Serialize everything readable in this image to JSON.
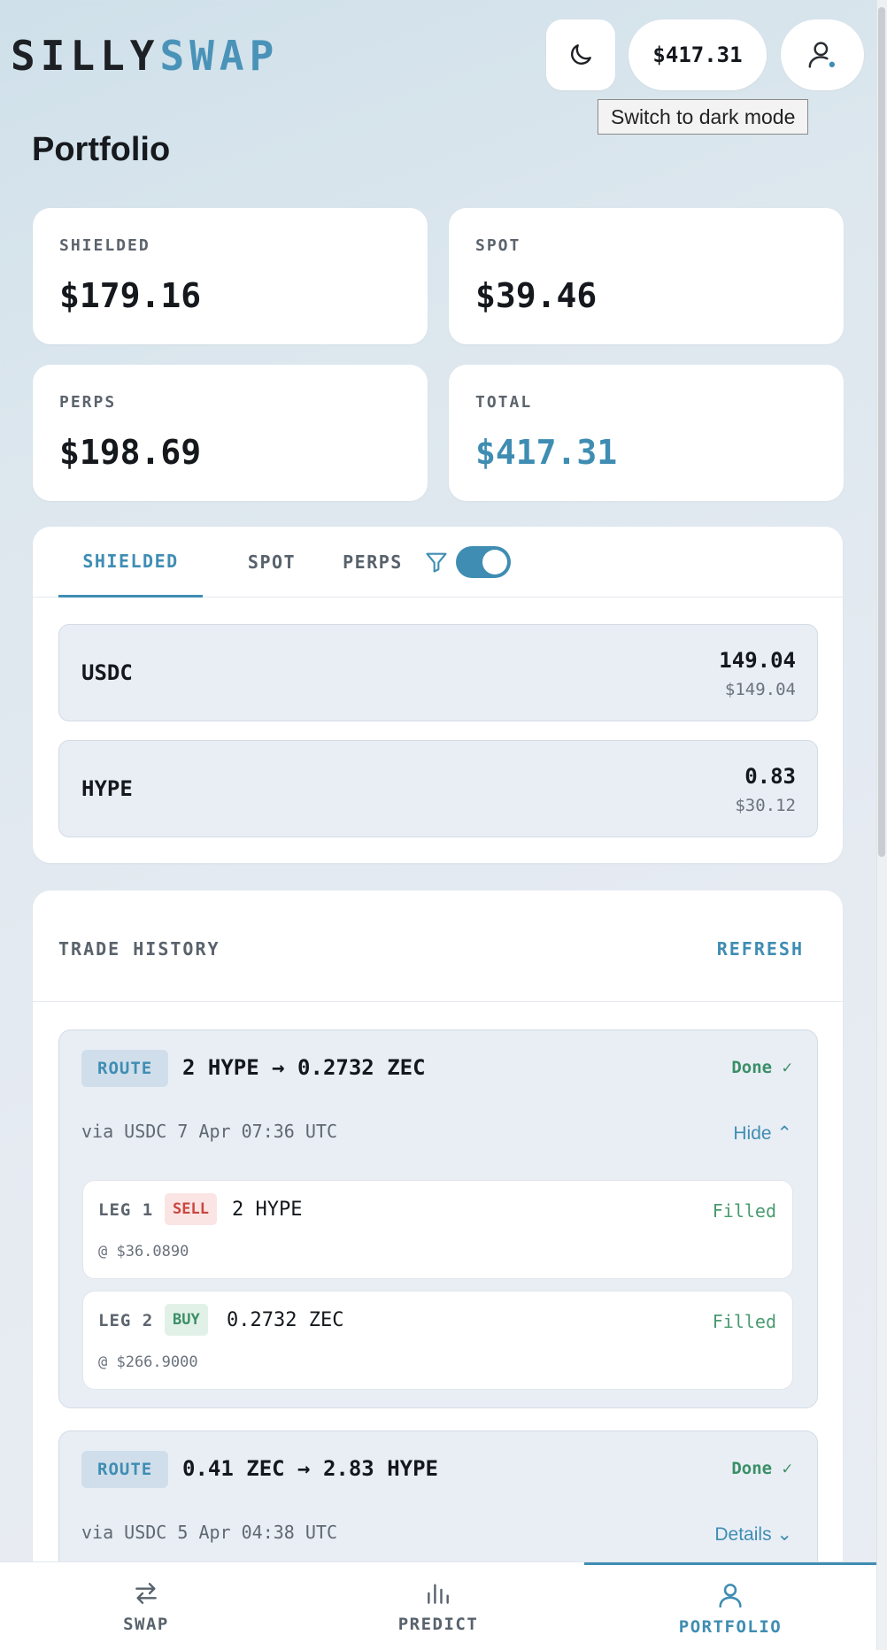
{
  "app": {
    "logo_part1": "SILLY",
    "logo_part2": "SWAP",
    "balance": "$417.31",
    "theme_tooltip": "Switch to dark mode"
  },
  "page": {
    "title": "Portfolio"
  },
  "summary": [
    {
      "label": "SHIELDED",
      "value": "$179.16"
    },
    {
      "label": "SPOT",
      "value": "$39.46"
    },
    {
      "label": "PERPS",
      "value": "$198.69"
    },
    {
      "label": "TOTAL",
      "value": "$417.31"
    }
  ],
  "holdings": {
    "tabs": [
      "SHIELDED",
      "SPOT",
      "PERPS"
    ],
    "active_tab": "SHIELDED",
    "filter_enabled": true,
    "assets": [
      {
        "symbol": "USDC",
        "amount": "149.04",
        "usd": "$149.04"
      },
      {
        "symbol": "HYPE",
        "amount": "0.83",
        "usd": "$30.12"
      }
    ]
  },
  "history": {
    "title": "TRADE HISTORY",
    "refresh_label": "REFRESH",
    "trades": [
      {
        "badge": "ROUTE",
        "summary": "2 HYPE → 0.2732 ZEC",
        "status": "Done ✓",
        "meta": "via USDC 7 Apr 07:36 UTC",
        "toggle": "Hide ⌃",
        "legs": [
          {
            "label": "LEG 1",
            "side": "SELL",
            "qty": "2 HYPE",
            "status": "Filled",
            "price": "@ $36.0890"
          },
          {
            "label": "LEG 2",
            "side": "BUY",
            "qty": "0.2732 ZEC",
            "status": "Filled",
            "price": "@ $266.9000"
          }
        ]
      },
      {
        "badge": "ROUTE",
        "summary": "0.41 ZEC → 2.83 HYPE",
        "status": "Done ✓",
        "meta": "via USDC 5 Apr 04:38 UTC",
        "toggle": "Details ⌄"
      }
    ]
  },
  "nav": {
    "items": [
      {
        "label": "SWAP",
        "icon": "swap-arrows-icon"
      },
      {
        "label": "PREDICT",
        "icon": "bar-chart-icon"
      },
      {
        "label": "PORTFOLIO",
        "icon": "user-icon"
      }
    ],
    "active": "PORTFOLIO"
  },
  "colors": {
    "accent": "#3f8db3",
    "success": "#3b8f66",
    "sell": "#c9463e"
  }
}
